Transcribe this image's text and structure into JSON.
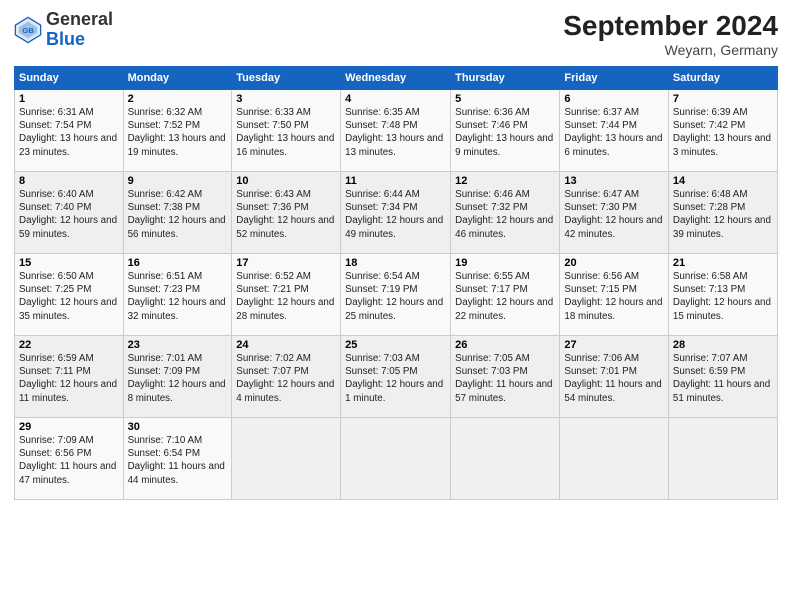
{
  "header": {
    "logo_general": "General",
    "logo_blue": "Blue",
    "month_year": "September 2024",
    "location": "Weyarn, Germany"
  },
  "days_of_week": [
    "Sunday",
    "Monday",
    "Tuesday",
    "Wednesday",
    "Thursday",
    "Friday",
    "Saturday"
  ],
  "weeks": [
    [
      {
        "day": "1",
        "sunrise": "6:31 AM",
        "sunset": "7:54 PM",
        "daylight": "13 hours and 23 minutes."
      },
      {
        "day": "2",
        "sunrise": "6:32 AM",
        "sunset": "7:52 PM",
        "daylight": "13 hours and 19 minutes."
      },
      {
        "day": "3",
        "sunrise": "6:33 AM",
        "sunset": "7:50 PM",
        "daylight": "13 hours and 16 minutes."
      },
      {
        "day": "4",
        "sunrise": "6:35 AM",
        "sunset": "7:48 PM",
        "daylight": "13 hours and 13 minutes."
      },
      {
        "day": "5",
        "sunrise": "6:36 AM",
        "sunset": "7:46 PM",
        "daylight": "13 hours and 9 minutes."
      },
      {
        "day": "6",
        "sunrise": "6:37 AM",
        "sunset": "7:44 PM",
        "daylight": "13 hours and 6 minutes."
      },
      {
        "day": "7",
        "sunrise": "6:39 AM",
        "sunset": "7:42 PM",
        "daylight": "13 hours and 3 minutes."
      }
    ],
    [
      {
        "day": "8",
        "sunrise": "6:40 AM",
        "sunset": "7:40 PM",
        "daylight": "12 hours and 59 minutes."
      },
      {
        "day": "9",
        "sunrise": "6:42 AM",
        "sunset": "7:38 PM",
        "daylight": "12 hours and 56 minutes."
      },
      {
        "day": "10",
        "sunrise": "6:43 AM",
        "sunset": "7:36 PM",
        "daylight": "12 hours and 52 minutes."
      },
      {
        "day": "11",
        "sunrise": "6:44 AM",
        "sunset": "7:34 PM",
        "daylight": "12 hours and 49 minutes."
      },
      {
        "day": "12",
        "sunrise": "6:46 AM",
        "sunset": "7:32 PM",
        "daylight": "12 hours and 46 minutes."
      },
      {
        "day": "13",
        "sunrise": "6:47 AM",
        "sunset": "7:30 PM",
        "daylight": "12 hours and 42 minutes."
      },
      {
        "day": "14",
        "sunrise": "6:48 AM",
        "sunset": "7:28 PM",
        "daylight": "12 hours and 39 minutes."
      }
    ],
    [
      {
        "day": "15",
        "sunrise": "6:50 AM",
        "sunset": "7:25 PM",
        "daylight": "12 hours and 35 minutes."
      },
      {
        "day": "16",
        "sunrise": "6:51 AM",
        "sunset": "7:23 PM",
        "daylight": "12 hours and 32 minutes."
      },
      {
        "day": "17",
        "sunrise": "6:52 AM",
        "sunset": "7:21 PM",
        "daylight": "12 hours and 28 minutes."
      },
      {
        "day": "18",
        "sunrise": "6:54 AM",
        "sunset": "7:19 PM",
        "daylight": "12 hours and 25 minutes."
      },
      {
        "day": "19",
        "sunrise": "6:55 AM",
        "sunset": "7:17 PM",
        "daylight": "12 hours and 22 minutes."
      },
      {
        "day": "20",
        "sunrise": "6:56 AM",
        "sunset": "7:15 PM",
        "daylight": "12 hours and 18 minutes."
      },
      {
        "day": "21",
        "sunrise": "6:58 AM",
        "sunset": "7:13 PM",
        "daylight": "12 hours and 15 minutes."
      }
    ],
    [
      {
        "day": "22",
        "sunrise": "6:59 AM",
        "sunset": "7:11 PM",
        "daylight": "12 hours and 11 minutes."
      },
      {
        "day": "23",
        "sunrise": "7:01 AM",
        "sunset": "7:09 PM",
        "daylight": "12 hours and 8 minutes."
      },
      {
        "day": "24",
        "sunrise": "7:02 AM",
        "sunset": "7:07 PM",
        "daylight": "12 hours and 4 minutes."
      },
      {
        "day": "25",
        "sunrise": "7:03 AM",
        "sunset": "7:05 PM",
        "daylight": "12 hours and 1 minute."
      },
      {
        "day": "26",
        "sunrise": "7:05 AM",
        "sunset": "7:03 PM",
        "daylight": "11 hours and 57 minutes."
      },
      {
        "day": "27",
        "sunrise": "7:06 AM",
        "sunset": "7:01 PM",
        "daylight": "11 hours and 54 minutes."
      },
      {
        "day": "28",
        "sunrise": "7:07 AM",
        "sunset": "6:59 PM",
        "daylight": "11 hours and 51 minutes."
      }
    ],
    [
      {
        "day": "29",
        "sunrise": "7:09 AM",
        "sunset": "6:56 PM",
        "daylight": "11 hours and 47 minutes."
      },
      {
        "day": "30",
        "sunrise": "7:10 AM",
        "sunset": "6:54 PM",
        "daylight": "11 hours and 44 minutes."
      },
      null,
      null,
      null,
      null,
      null
    ]
  ]
}
